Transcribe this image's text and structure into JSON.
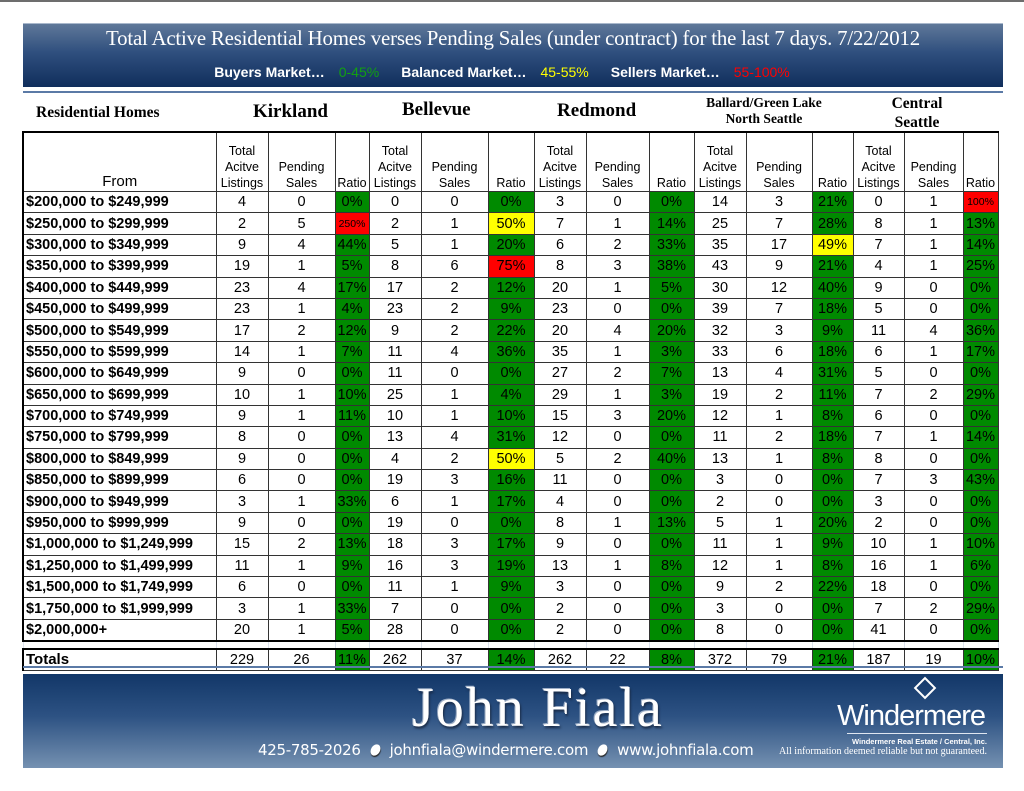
{
  "header": {
    "title": "Total Active Residential Homes verses Pending Sales (under contract) for the last 7 days. 7/22/2012",
    "legend": [
      {
        "label": "Buyers Market…",
        "range": "0-45%",
        "color": "#11a011"
      },
      {
        "label": "Balanced Market…",
        "range": "45-55%",
        "color": "#ffff00"
      },
      {
        "label": "Sellers Market…",
        "range": "55-100%",
        "color": "#ff0000"
      }
    ]
  },
  "table": {
    "section_title": "Residential Homes",
    "regions": [
      "Kirkland",
      "Bellevue",
      "Redmond",
      "Ballard/Green Lake North Seattle",
      "Central Seattle"
    ],
    "region_lines": {
      "ballard_1": "Ballard/Green Lake",
      "ballard_2": "North Seattle",
      "central_1": "Central",
      "central_2": "Seattle"
    },
    "columns": {
      "from": "From",
      "total": [
        "Total",
        "Acitve",
        "Listings"
      ],
      "pending": [
        "Pending",
        "Sales"
      ],
      "ratio": "Ratio"
    },
    "status_colors": {
      "buyers": "#008a00",
      "balanced": "#ffff00",
      "sellers": "#ff0000"
    },
    "rows": [
      {
        "range": "$200,000 to $249,999",
        "cells": [
          [
            "4",
            "0",
            "0%",
            "g"
          ],
          [
            "0",
            "0",
            "0%",
            "g"
          ],
          [
            "3",
            "0",
            "0%",
            "g"
          ],
          [
            "14",
            "3",
            "21%",
            "g"
          ],
          [
            "0",
            "1",
            "100%",
            "r"
          ]
        ]
      },
      {
        "range": "$250,000 to $299,999",
        "cells": [
          [
            "2",
            "5",
            "250%",
            "r"
          ],
          [
            "2",
            "1",
            "50%",
            "y"
          ],
          [
            "7",
            "1",
            "14%",
            "g"
          ],
          [
            "25",
            "7",
            "28%",
            "g"
          ],
          [
            "8",
            "1",
            "13%",
            "g"
          ]
        ]
      },
      {
        "range": "$300,000 to $349,999",
        "cells": [
          [
            "9",
            "4",
            "44%",
            "g"
          ],
          [
            "5",
            "1",
            "20%",
            "g"
          ],
          [
            "6",
            "2",
            "33%",
            "g"
          ],
          [
            "35",
            "17",
            "49%",
            "y"
          ],
          [
            "7",
            "1",
            "14%",
            "g"
          ]
        ]
      },
      {
        "range": "$350,000 to $399,999",
        "cells": [
          [
            "19",
            "1",
            "5%",
            "g"
          ],
          [
            "8",
            "6",
            "75%",
            "r"
          ],
          [
            "8",
            "3",
            "38%",
            "g"
          ],
          [
            "43",
            "9",
            "21%",
            "g"
          ],
          [
            "4",
            "1",
            "25%",
            "g"
          ]
        ]
      },
      {
        "range": "$400,000 to $449,999",
        "cells": [
          [
            "23",
            "4",
            "17%",
            "g"
          ],
          [
            "17",
            "2",
            "12%",
            "g"
          ],
          [
            "20",
            "1",
            "5%",
            "g"
          ],
          [
            "30",
            "12",
            "40%",
            "g"
          ],
          [
            "9",
            "0",
            "0%",
            "g"
          ]
        ]
      },
      {
        "range": "$450,000 to $499,999",
        "cells": [
          [
            "23",
            "1",
            "4%",
            "g"
          ],
          [
            "23",
            "2",
            "9%",
            "g"
          ],
          [
            "23",
            "0",
            "0%",
            "g"
          ],
          [
            "39",
            "7",
            "18%",
            "g"
          ],
          [
            "5",
            "0",
            "0%",
            "g"
          ]
        ]
      },
      {
        "range": "$500,000 to $549,999",
        "cells": [
          [
            "17",
            "2",
            "12%",
            "g"
          ],
          [
            "9",
            "2",
            "22%",
            "g"
          ],
          [
            "20",
            "4",
            "20%",
            "g"
          ],
          [
            "32",
            "3",
            "9%",
            "g"
          ],
          [
            "11",
            "4",
            "36%",
            "g"
          ]
        ]
      },
      {
        "range": "$550,000 to $599,999",
        "cells": [
          [
            "14",
            "1",
            "7%",
            "g"
          ],
          [
            "11",
            "4",
            "36%",
            "g"
          ],
          [
            "35",
            "1",
            "3%",
            "g"
          ],
          [
            "33",
            "6",
            "18%",
            "g"
          ],
          [
            "6",
            "1",
            "17%",
            "g"
          ]
        ]
      },
      {
        "range": "$600,000 to $649,999",
        "cells": [
          [
            "9",
            "0",
            "0%",
            "g"
          ],
          [
            "11",
            "0",
            "0%",
            "g"
          ],
          [
            "27",
            "2",
            "7%",
            "g"
          ],
          [
            "13",
            "4",
            "31%",
            "g"
          ],
          [
            "5",
            "0",
            "0%",
            "g"
          ]
        ]
      },
      {
        "range": "$650,000 to $699,999",
        "cells": [
          [
            "10",
            "1",
            "10%",
            "g"
          ],
          [
            "25",
            "1",
            "4%",
            "g"
          ],
          [
            "29",
            "1",
            "3%",
            "g"
          ],
          [
            "19",
            "2",
            "11%",
            "g"
          ],
          [
            "7",
            "2",
            "29%",
            "g"
          ]
        ]
      },
      {
        "range": "$700,000 to $749,999",
        "cells": [
          [
            "9",
            "1",
            "11%",
            "g"
          ],
          [
            "10",
            "1",
            "10%",
            "g"
          ],
          [
            "15",
            "3",
            "20%",
            "g"
          ],
          [
            "12",
            "1",
            "8%",
            "g"
          ],
          [
            "6",
            "0",
            "0%",
            "g"
          ]
        ]
      },
      {
        "range": "$750,000 to $799,999",
        "cells": [
          [
            "8",
            "0",
            "0%",
            "g"
          ],
          [
            "13",
            "4",
            "31%",
            "g"
          ],
          [
            "12",
            "0",
            "0%",
            "g"
          ],
          [
            "11",
            "2",
            "18%",
            "g"
          ],
          [
            "7",
            "1",
            "14%",
            "g"
          ]
        ]
      },
      {
        "range": "$800,000 to $849,999",
        "cells": [
          [
            "9",
            "0",
            "0%",
            "g"
          ],
          [
            "4",
            "2",
            "50%",
            "y"
          ],
          [
            "5",
            "2",
            "40%",
            "g"
          ],
          [
            "13",
            "1",
            "8%",
            "g"
          ],
          [
            "8",
            "0",
            "0%",
            "g"
          ]
        ]
      },
      {
        "range": "$850,000 to $899,999",
        "cells": [
          [
            "6",
            "0",
            "0%",
            "g"
          ],
          [
            "19",
            "3",
            "16%",
            "g"
          ],
          [
            "11",
            "0",
            "0%",
            "g"
          ],
          [
            "3",
            "0",
            "0%",
            "g"
          ],
          [
            "7",
            "3",
            "43%",
            "g"
          ]
        ]
      },
      {
        "range": "$900,000 to $949,999",
        "cells": [
          [
            "3",
            "1",
            "33%",
            "g"
          ],
          [
            "6",
            "1",
            "17%",
            "g"
          ],
          [
            "4",
            "0",
            "0%",
            "g"
          ],
          [
            "2",
            "0",
            "0%",
            "g"
          ],
          [
            "3",
            "0",
            "0%",
            "g"
          ]
        ]
      },
      {
        "range": "$950,000 to $999,999",
        "cells": [
          [
            "9",
            "0",
            "0%",
            "g"
          ],
          [
            "19",
            "0",
            "0%",
            "g"
          ],
          [
            "8",
            "1",
            "13%",
            "g"
          ],
          [
            "5",
            "1",
            "20%",
            "g"
          ],
          [
            "2",
            "0",
            "0%",
            "g"
          ]
        ]
      },
      {
        "range": "$1,000,000 to $1,249,999",
        "cells": [
          [
            "15",
            "2",
            "13%",
            "g"
          ],
          [
            "18",
            "3",
            "17%",
            "g"
          ],
          [
            "9",
            "0",
            "0%",
            "g"
          ],
          [
            "11",
            "1",
            "9%",
            "g"
          ],
          [
            "10",
            "1",
            "10%",
            "g"
          ]
        ]
      },
      {
        "range": "$1,250,000 to $1,499,999",
        "cells": [
          [
            "11",
            "1",
            "9%",
            "g"
          ],
          [
            "16",
            "3",
            "19%",
            "g"
          ],
          [
            "13",
            "1",
            "8%",
            "g"
          ],
          [
            "12",
            "1",
            "8%",
            "g"
          ],
          [
            "16",
            "1",
            "6%",
            "g"
          ]
        ]
      },
      {
        "range": "$1,500,000 to $1,749,999",
        "cells": [
          [
            "6",
            "0",
            "0%",
            "g"
          ],
          [
            "11",
            "1",
            "9%",
            "g"
          ],
          [
            "3",
            "0",
            "0%",
            "g"
          ],
          [
            "9",
            "2",
            "22%",
            "g"
          ],
          [
            "18",
            "0",
            "0%",
            "g"
          ]
        ]
      },
      {
        "range": "$1,750,000 to $1,999,999",
        "cells": [
          [
            "3",
            "1",
            "33%",
            "g"
          ],
          [
            "7",
            "0",
            "0%",
            "g"
          ],
          [
            "2",
            "0",
            "0%",
            "g"
          ],
          [
            "3",
            "0",
            "0%",
            "g"
          ],
          [
            "7",
            "2",
            "29%",
            "g"
          ]
        ]
      },
      {
        "range": "$2,000,000+",
        "cells": [
          [
            "20",
            "1",
            "5%",
            "g"
          ],
          [
            "28",
            "0",
            "0%",
            "g"
          ],
          [
            "2",
            "0",
            "0%",
            "g"
          ],
          [
            "8",
            "0",
            "0%",
            "g"
          ],
          [
            "41",
            "0",
            "0%",
            "g"
          ]
        ]
      }
    ],
    "totals": {
      "label": "Totals",
      "cells": [
        [
          "229",
          "26",
          "11%",
          "g"
        ],
        [
          "262",
          "37",
          "14%",
          "g"
        ],
        [
          "262",
          "22",
          "8%",
          "g"
        ],
        [
          "372",
          "79",
          "21%",
          "g"
        ],
        [
          "187",
          "19",
          "10%",
          "g"
        ]
      ]
    }
  },
  "footer": {
    "agent_name": "John Fiala",
    "phone": "425-785-2026",
    "email": "johnfiala@windermere.com",
    "website": "www.johnfiala.com",
    "brand_name": "Windermere",
    "brand_company": "Windermere Real Estate / Central, Inc.",
    "disclaimer": "All information deemed reliable but not guaranteed."
  }
}
